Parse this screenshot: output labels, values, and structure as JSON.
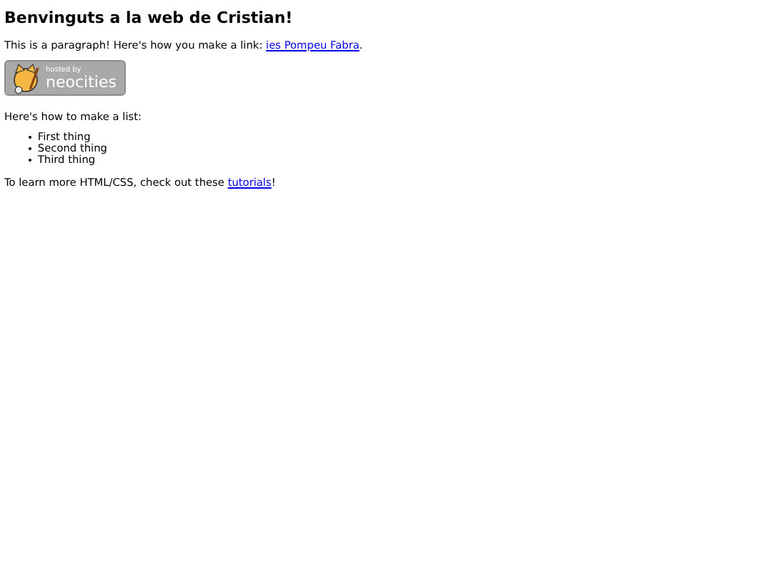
{
  "heading": "Benvinguts a la web de Cristian!",
  "intro": {
    "text": "This is a paragraph! Here's how you make a link: ",
    "link": "ies Pompeu Fabra",
    "after": "."
  },
  "badge": {
    "line_1": "hosted by",
    "line_2": "neocities"
  },
  "list_intro": "Here's how to make a list:",
  "list": [
    "First thing",
    "Second thing",
    "Third thing"
  ],
  "outro": {
    "text": "To learn more HTML/CSS, check out these ",
    "link": "tutorials",
    "after": "!"
  }
}
